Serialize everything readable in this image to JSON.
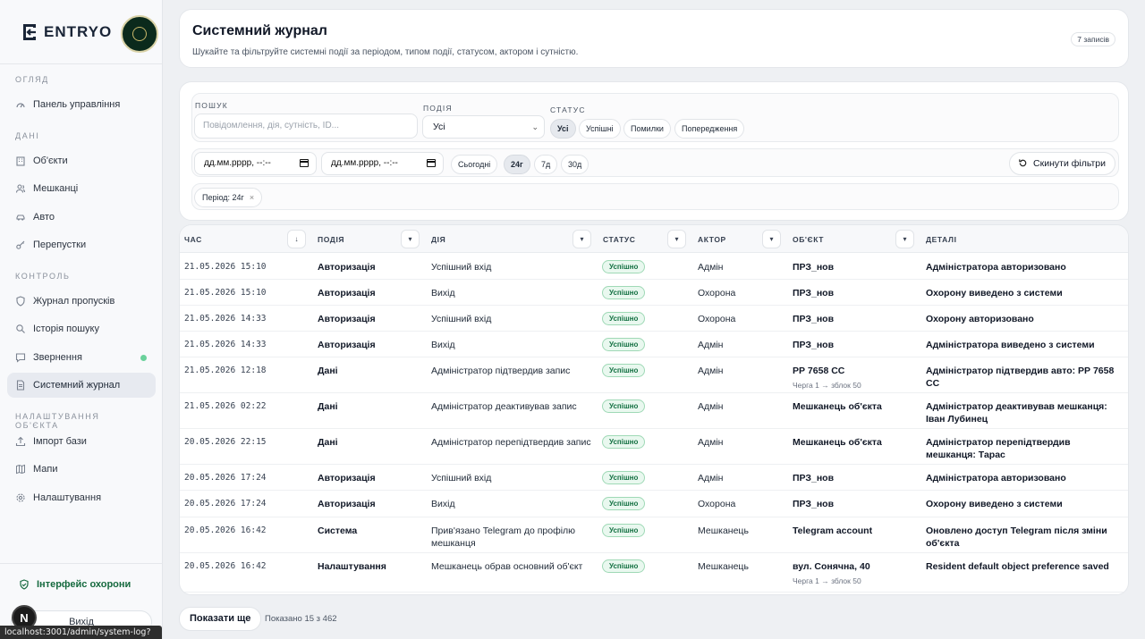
{
  "brand": {
    "name": "ENTRYO"
  },
  "sidebar": {
    "sections": [
      {
        "title": "ОГЛЯД",
        "items": [
          {
            "label": "Панель управління",
            "icon": "dashboard-icon"
          }
        ]
      },
      {
        "title": "ДАНІ",
        "items": [
          {
            "label": "Об'єкти",
            "icon": "building-icon"
          },
          {
            "label": "Мешканці",
            "icon": "users-icon"
          },
          {
            "label": "Авто",
            "icon": "car-icon"
          },
          {
            "label": "Перепустки",
            "icon": "key-icon"
          }
        ]
      },
      {
        "title": "КОНТРОЛЬ",
        "items": [
          {
            "label": "Журнал пропусків",
            "icon": "shield-icon"
          },
          {
            "label": "Історія пошуку",
            "icon": "search-icon"
          },
          {
            "label": "Звернення",
            "icon": "message-icon"
          },
          {
            "label": "Системний журнал",
            "icon": "document-icon"
          }
        ]
      },
      {
        "title": "НАЛАШТУВАННЯ ОБ'ЄКТА",
        "items": [
          {
            "label": "Імпорт бази",
            "icon": "upload-icon"
          },
          {
            "label": "Мапи",
            "icon": "map-icon"
          },
          {
            "label": "Налаштування",
            "icon": "gear-icon"
          }
        ]
      }
    ],
    "guard_link": "Інтерфейс охорони",
    "logout": "Вихід",
    "n_badge": "N",
    "status_url": "localhost:3001/admin/system-log?community=pr3-nov"
  },
  "header": {
    "title": "Системний журнал",
    "subtitle": "Шукайте та фільтруйте системні події за періодом, типом події, статусом, актором і сутністю.",
    "count": "7 записів"
  },
  "filters": {
    "search_label": "ПОШУК",
    "search_placeholder": "Повідомлення, дія, сутність, ID...",
    "event_label": "ПОДІЯ",
    "event_value": "Усі",
    "status_label": "СТАТУС",
    "status_chips": [
      "Усі",
      "Успішні",
      "Помилки",
      "Попередження"
    ],
    "date_from": "дд.мм.рррр, --:--",
    "date_to": "дд.мм.рррр, --:--",
    "period_chips": [
      "Сьогодні",
      "24г",
      "7д",
      "30д"
    ],
    "reset": "Скинути фільтри",
    "active_period": "Період: 24г",
    "active_period_remove": "×"
  },
  "table": {
    "columns": [
      "ЧАС",
      "ПОДІЯ",
      "ДІЯ",
      "СТАТУС",
      "АКТОР",
      "ОБ'ЄКТ",
      "ДЕТАЛІ"
    ],
    "time_sort": "↓",
    "col_menu": "▾",
    "rows": [
      {
        "time": "21.05.2026 15:10",
        "event": "Авторизація",
        "action": "Успішний вхід",
        "status": "Успішно",
        "actor": "Адмін",
        "object": "ПРЗ_нов",
        "object_sub": "",
        "details": "Адміністратора авторизовано"
      },
      {
        "time": "21.05.2026 15:10",
        "event": "Авторизація",
        "action": "Вихід",
        "status": "Успішно",
        "actor": "Охорона",
        "object": "ПРЗ_нов",
        "object_sub": "",
        "details": "Охорону виведено з системи"
      },
      {
        "time": "21.05.2026 14:33",
        "event": "Авторизація",
        "action": "Успішний вхід",
        "status": "Успішно",
        "actor": "Охорона",
        "object": "ПРЗ_нов",
        "object_sub": "",
        "details": "Охорону авторизовано"
      },
      {
        "time": "21.05.2026 14:33",
        "event": "Авторизація",
        "action": "Вихід",
        "status": "Успішно",
        "actor": "Адмін",
        "object": "ПРЗ_нов",
        "object_sub": "",
        "details": "Адміністратора виведено з системи"
      },
      {
        "time": "21.05.2026 12:18",
        "event": "Дані",
        "action": "Адміністратор підтвердив запис",
        "status": "Успішно",
        "actor": "Адмін",
        "object": "РР 7658 СС",
        "object_sub": "Черга 1 → зблок 50",
        "details": "Адміністратор підтвердив авто: РР 7658 СС"
      },
      {
        "time": "21.05.2026 02:22",
        "event": "Дані",
        "action": "Адміністратор деактивував запис",
        "status": "Успішно",
        "actor": "Адмін",
        "object": "Мешканець об'єкта",
        "object_sub": "",
        "details": "Адміністратор деактивував мешканця: Іван Лубинец"
      },
      {
        "time": "20.05.2026 22:15",
        "event": "Дані",
        "action": "Адміністратор перепідтвердив запис",
        "status": "Успішно",
        "actor": "Адмін",
        "object": "Мешканець об'єкта",
        "object_sub": "",
        "details": "Адміністратор перепідтвердив мешканця: Тарас"
      },
      {
        "time": "20.05.2026 17:24",
        "event": "Авторизація",
        "action": "Успішний вхід",
        "status": "Успішно",
        "actor": "Адмін",
        "object": "ПРЗ_нов",
        "object_sub": "",
        "details": "Адміністратора авторизовано"
      },
      {
        "time": "20.05.2026 17:24",
        "event": "Авторизація",
        "action": "Вихід",
        "status": "Успішно",
        "actor": "Охорона",
        "object": "ПРЗ_нов",
        "object_sub": "",
        "details": "Охорону виведено з системи"
      },
      {
        "time": "20.05.2026 16:42",
        "event": "Система",
        "action": "Прив'язано Telegram до профілю мешканця",
        "status": "Успішно",
        "actor": "Мешканець",
        "object": "Telegram account",
        "object_sub": "",
        "details": "Оновлено доступ Telegram після зміни об'єкта"
      },
      {
        "time": "20.05.2026 16:42",
        "event": "Налаштування",
        "action": "Мешканець обрав основний об'єкт",
        "status": "Успішно",
        "actor": "Мешканець",
        "object": "вул. Сонячна, 40",
        "object_sub": "Черга 1 → зблок 50",
        "details": "Resident default object preference saved"
      }
    ]
  },
  "footer": {
    "show_more": "Показати ще",
    "shown": "Показано 15 з 462"
  },
  "colors": {
    "accent_green": "#137042",
    "status_bg": "#e9f8ef",
    "sidebar_bg": "#f8f9fb",
    "page_bg": "#eef0f3"
  }
}
